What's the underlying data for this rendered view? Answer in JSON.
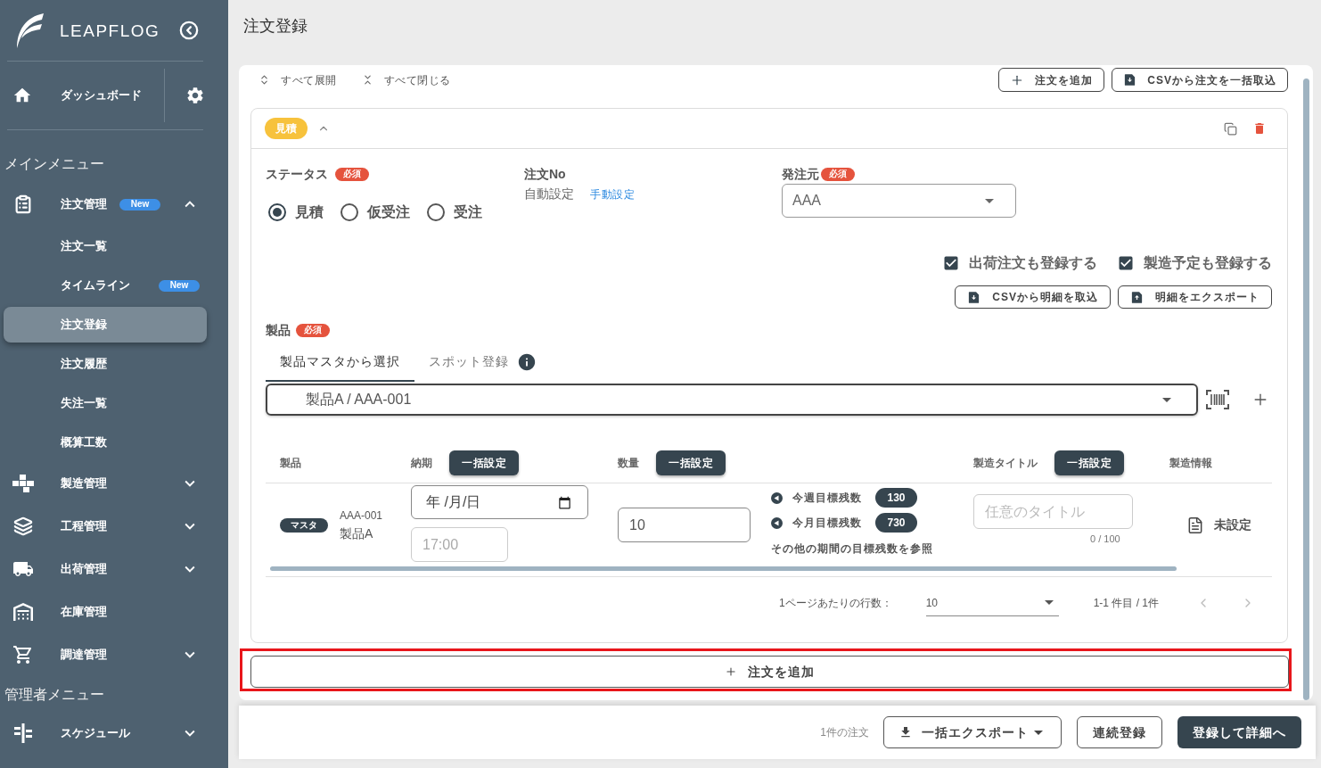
{
  "sidebar": {
    "logo": "LEAPFLOG",
    "dashboard": {
      "label": "ダッシュボード",
      "selected": false
    },
    "sections": [
      {
        "title": "メインメニュー",
        "items": [
          {
            "kind": "group",
            "label": "注文管理",
            "badge": "New",
            "expanded": true,
            "children": [
              {
                "label": "注文一覧",
                "selected": false
              },
              {
                "label": "タイムライン",
                "badge": "New",
                "selected": false
              },
              {
                "label": "注文登録",
                "selected": true
              },
              {
                "label": "注文履歴",
                "selected": false
              },
              {
                "label": "失注一覧",
                "selected": false
              },
              {
                "label": "概算工数",
                "selected": false
              }
            ]
          },
          {
            "kind": "group",
            "label": "製造管理",
            "expanded": false
          },
          {
            "kind": "group",
            "label": "工程管理",
            "expanded": false
          },
          {
            "kind": "group",
            "label": "出荷管理",
            "expanded": false
          },
          {
            "kind": "link",
            "label": "在庫管理"
          },
          {
            "kind": "group",
            "label": "調達管理",
            "expanded": false
          }
        ]
      },
      {
        "title": "管理者メニュー",
        "items": [
          {
            "kind": "group",
            "label": "スケジュール",
            "expanded": false
          }
        ]
      }
    ]
  },
  "page_title": "注文登録",
  "toolbar": {
    "expand_all": "すべて展開",
    "collapse_all": "すべて閉じる",
    "buttons": [
      {
        "kind": "add",
        "label": "注文を追加"
      },
      {
        "kind": "import",
        "label": "CSVから注文を一括取込"
      }
    ]
  },
  "order": {
    "status_tag": "見積",
    "expanded": true,
    "status": {
      "label": "ステータス",
      "required": "必須",
      "options": [
        {
          "label": "見積",
          "selected": true
        },
        {
          "label": "仮受注",
          "selected": false
        },
        {
          "label": "受注",
          "selected": false
        }
      ]
    },
    "order_no": {
      "label": "注文No",
      "value": "自動設定",
      "link": "手動設定"
    },
    "client": {
      "label": "発注元",
      "required": "必須",
      "value": "AAA"
    },
    "options": [
      {
        "label": "出荷注文も登録する",
        "checked": true
      },
      {
        "label": "製造予定も登録する",
        "checked": true
      }
    ],
    "detail_buttons": [
      {
        "kind": "import",
        "label": "CSVから明細を取込"
      },
      {
        "kind": "export",
        "label": "明細をエクスポート"
      }
    ],
    "product": {
      "label": "製品",
      "required": "必須",
      "tabs": [
        {
          "label": "製品マスタから選択",
          "selected": true
        },
        {
          "label": "スポット登録",
          "selected": false
        }
      ],
      "value": "製品A / AAA-001"
    },
    "table": {
      "columns": [
        {
          "label": "製品"
        },
        {
          "label": "納期",
          "action": "一括設定"
        },
        {
          "label": "数量",
          "action": "一括設定"
        },
        {
          "label": "製造タイトル",
          "action": "一括設定"
        },
        {
          "label": "製造情報"
        }
      ],
      "rows": [
        {
          "tag": "マスタ",
          "code": "AAA-001",
          "name": "製品A",
          "due_date": "年 /月/日",
          "due_time_placeholder": "17:00",
          "quantity": "10",
          "targets": [
            {
              "label": "今週目標残数",
              "value": "130"
            },
            {
              "label": "今月目標残数",
              "value": "730"
            }
          ],
          "targets_link": "その他の期間の目標残数を参照",
          "title_placeholder": "任意のタイトル",
          "title_counter": "0 / 100",
          "production_info": "未設定"
        }
      ]
    },
    "pagination": {
      "rows_per_page_label": "1ページあたりの行数：",
      "rows_per_page": "10",
      "range": "1-1 件目 / 1件",
      "previous_disabled": true,
      "next_disabled": true
    }
  },
  "add_order": {
    "label": "注文を追加",
    "highlighted": true
  },
  "footer": {
    "count": "1件の注文",
    "buttons": [
      {
        "kind": "export",
        "label": "一括エクスポート"
      },
      {
        "kind": "outline",
        "label": "連続登録"
      },
      {
        "kind": "primary",
        "label": "登録して詳細へ"
      }
    ]
  }
}
